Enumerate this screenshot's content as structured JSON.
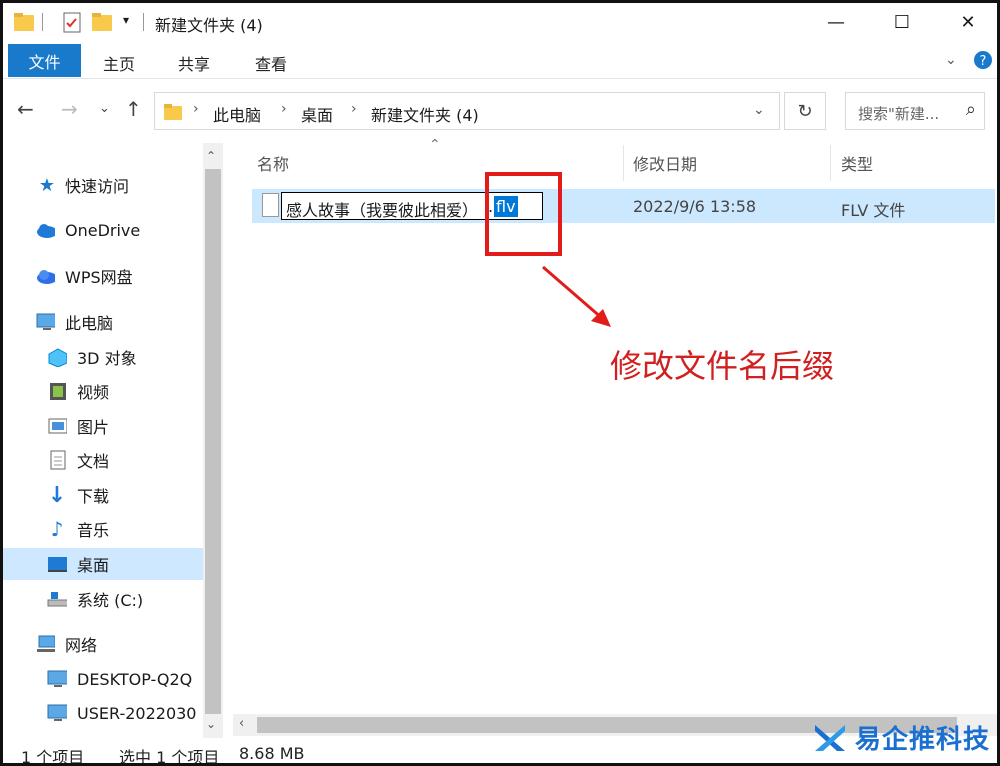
{
  "window": {
    "title": "新建文件夹 (4)",
    "controls": [
      "—",
      "☐",
      "✕"
    ]
  },
  "ribbon": {
    "tabs": [
      "文件",
      "主页",
      "共享",
      "查看"
    ]
  },
  "address": {
    "crumbs": [
      "此电脑",
      "桌面",
      "新建文件夹 (4)"
    ],
    "search_placeholder": "搜索\"新建..."
  },
  "sidebar": {
    "items": [
      {
        "label": "快速访问",
        "icon": "star-icon"
      },
      {
        "label": "OneDrive",
        "icon": "cloud-icon"
      },
      {
        "label": "WPS网盘",
        "icon": "wps-cloud-icon"
      },
      {
        "label": "此电脑",
        "icon": "computer-icon"
      },
      {
        "label": "3D 对象",
        "icon": "cube-icon"
      },
      {
        "label": "视频",
        "icon": "video-icon"
      },
      {
        "label": "图片",
        "icon": "picture-icon"
      },
      {
        "label": "文档",
        "icon": "document-icon"
      },
      {
        "label": "下载",
        "icon": "download-icon"
      },
      {
        "label": "音乐",
        "icon": "music-icon"
      },
      {
        "label": "桌面",
        "icon": "desktop-icon"
      },
      {
        "label": "系统 (C:)",
        "icon": "drive-icon"
      },
      {
        "label": "网络",
        "icon": "network-icon"
      },
      {
        "label": "DESKTOP-Q2Q",
        "icon": "monitor-icon"
      },
      {
        "label": "USER-2022030",
        "icon": "monitor-icon"
      }
    ]
  },
  "list": {
    "columns": [
      "名称",
      "修改日期",
      "类型"
    ],
    "file": {
      "name": "感人故事（我要彼此相爱）",
      "dot": ".",
      "ext": "flv",
      "modified": "2022/9/6 13:58",
      "type": "FLV 文件"
    }
  },
  "annotation": {
    "text": "修改文件名后缀",
    "color": "#d02020"
  },
  "status": {
    "count": "1 个项目",
    "selected": "选中 1 个项目",
    "size": "8.68 MB"
  },
  "watermark": {
    "text": "易企推科技"
  },
  "colors": {
    "accent": "#1979ca",
    "selection": "#cce8ff",
    "highlight": "#0078d7"
  }
}
